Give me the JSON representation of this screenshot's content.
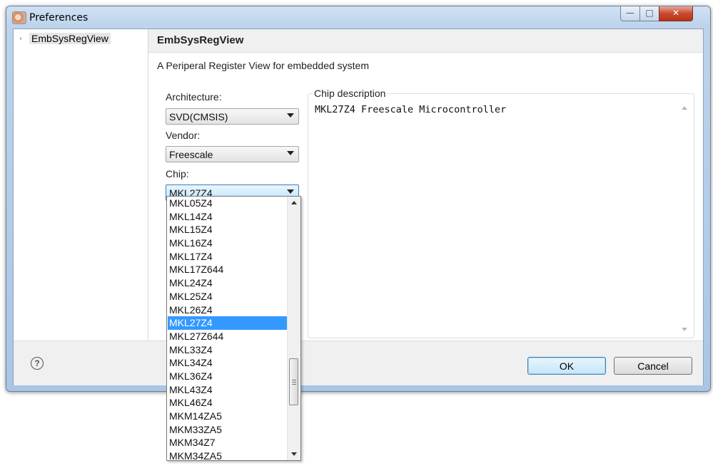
{
  "window": {
    "title": "Preferences",
    "icon": "preferences-app-icon"
  },
  "tree": {
    "items": [
      {
        "label": "EmbSysRegView",
        "expanded": false
      }
    ]
  },
  "pane": {
    "title": "EmbSysRegView",
    "description": "A Periperal Register View for embedded system",
    "architecture": {
      "label": "Architecture:",
      "value": "SVD(CMSIS)"
    },
    "vendor": {
      "label": "Vendor:",
      "value": "Freescale"
    },
    "chip": {
      "label": "Chip:",
      "value": "MKL27Z4"
    },
    "chip_description": {
      "label": "Chip description",
      "text": "MKL27Z4 Freescale Microcontroller"
    }
  },
  "dropdown": {
    "items": [
      "MKL05Z4",
      "MKL14Z4",
      "MKL15Z4",
      "MKL16Z4",
      "MKL17Z4",
      "MKL17Z644",
      "MKL24Z4",
      "MKL25Z4",
      "MKL26Z4",
      "MKL27Z4",
      "MKL27Z644",
      "MKL33Z4",
      "MKL34Z4",
      "MKL36Z4",
      "MKL43Z4",
      "MKL46Z4",
      "MKM14ZA5",
      "MKM33ZA5",
      "MKM34Z7",
      "MKM34ZA5"
    ],
    "selected": "MKL27Z4"
  },
  "buttons": {
    "ok": "OK",
    "cancel": "Cancel",
    "help": "?"
  },
  "colors": {
    "selection": "#3399ff",
    "close_button": "#c9492e",
    "accent_border": "#3c7fb1"
  }
}
